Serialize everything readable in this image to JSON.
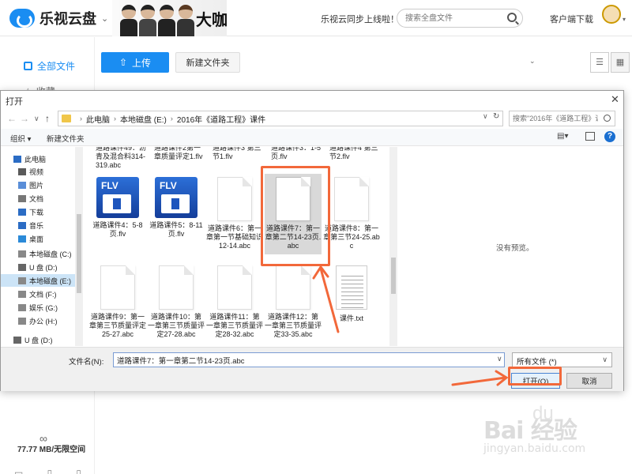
{
  "app": {
    "logo_text": "乐视云盘",
    "banner_text": "大咖",
    "sync_notice": "乐视云同步上线啦！",
    "search_placeholder": "搜索全盘文件",
    "client_download": "客户端下载",
    "sidebar": {
      "all_files": "全部文件",
      "favorites": "收藏",
      "storage_icon": "∞",
      "storage": "77.77 MB/无限空间"
    },
    "toolbar": {
      "upload": "上传",
      "new_folder": "新建文件夹"
    }
  },
  "dialog": {
    "title": "打开",
    "close": "✕",
    "nav": {
      "back": "←",
      "forward": "→",
      "dropdown": "∨",
      "up": "↑"
    },
    "breadcrumb": [
      "此电脑",
      "本地磁盘 (E:)",
      "2016年《道路工程》课件"
    ],
    "search_placeholder": "搜索\"2016年《道路工程》课...",
    "organize": "组织 ▾",
    "new_folder": "新建文件夹",
    "tree": [
      {
        "label": "此电脑",
        "icon": "computer-icon",
        "selected": false
      },
      {
        "label": "视频",
        "icon": "video-folder-icon",
        "selected": false
      },
      {
        "label": "图片",
        "icon": "pictures-folder-icon",
        "selected": false
      },
      {
        "label": "文档",
        "icon": "documents-folder-icon",
        "selected": false
      },
      {
        "label": "下载",
        "icon": "download-icon",
        "selected": false
      },
      {
        "label": "音乐",
        "icon": "music-icon",
        "selected": false
      },
      {
        "label": "桌面",
        "icon": "desktop-icon",
        "selected": false
      },
      {
        "label": "本地磁盘 (C:)",
        "icon": "drive-icon",
        "selected": false
      },
      {
        "label": "U 盘 (D:)",
        "icon": "usb-drive-icon",
        "selected": false
      },
      {
        "label": "本地磁盘 (E:)",
        "icon": "drive-icon",
        "selected": true
      },
      {
        "label": "文档 (F:)",
        "icon": "drive-icon",
        "selected": false
      },
      {
        "label": "娱乐 (G:)",
        "icon": "drive-icon",
        "selected": false
      },
      {
        "label": "办公 (H:)",
        "icon": "drive-icon",
        "selected": false
      },
      {
        "label": "U 盘 (D:)",
        "icon": "usb-drive-icon",
        "selected": false
      }
    ],
    "partial_row": [
      "道路课件49：沥青及混合料314-319.abc",
      "道路课件2第一章质量评定1.flv",
      "道路课件3 第三节1.flv",
      "道路课件3：1-5页.flv",
      "道路课件4 第三节2.flv"
    ],
    "files": [
      {
        "name": "道路课件4：5-8页.flv",
        "type": "flv"
      },
      {
        "name": "道路课件5：8-11页.flv",
        "type": "flv"
      },
      {
        "name": "道路课件6：第一章第一节基础知识12-14.abc",
        "type": "doc"
      },
      {
        "name": "道路课件7：第一章第二节14-23页.abc",
        "type": "doc",
        "selected": true
      },
      {
        "name": "道路课件8：第一章第三节24-25.abc",
        "type": "doc"
      },
      {
        "name": "道路课件9：第一章第三节质量评定25-27.abc",
        "type": "doc"
      },
      {
        "name": "道路课件10：第一章第三节质量评定27-28.abc",
        "type": "doc"
      },
      {
        "name": "道路课件11：第一章第三节质量评定28-32.abc",
        "type": "doc"
      },
      {
        "name": "道路课件12：第一章第三节质量评定33-35.abc",
        "type": "doc"
      },
      {
        "name": "课件.txt",
        "type": "txt"
      }
    ],
    "no_preview": "没有预览。",
    "filename_label": "文件名(N):",
    "filename_value": "道路课件7：第一章第二节14-23页.abc",
    "filetype": "所有文件 (*)",
    "open_button": "打开(O)",
    "cancel_button": "取消"
  },
  "watermark": {
    "brand": "Bai 经验",
    "paw": "du",
    "site": "jingyan.baidu.com"
  },
  "colors": {
    "accent": "#1a8df2",
    "annotation": "#f2683a",
    "selected_tree": "#cce4f7"
  }
}
